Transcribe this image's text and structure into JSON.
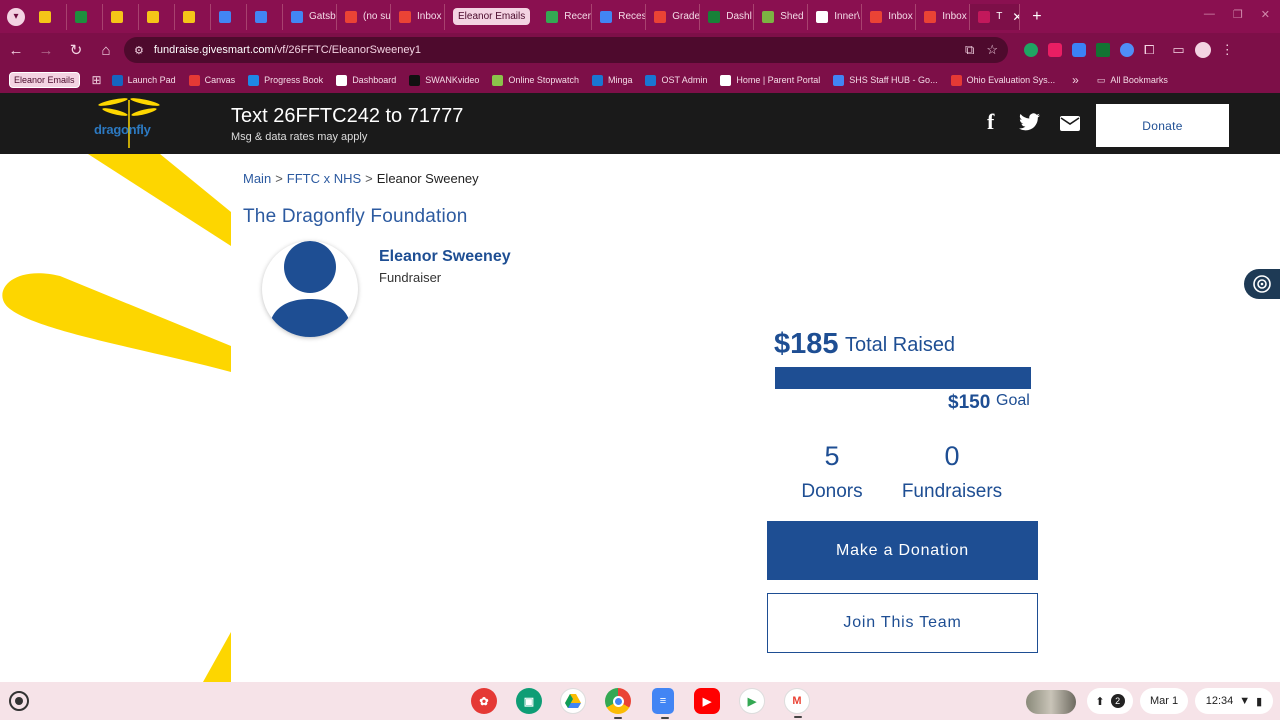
{
  "browser": {
    "tabs": [
      {
        "label": "",
        "color": "#f5c518"
      },
      {
        "label": "",
        "color": "#1e8e3e"
      },
      {
        "label": "",
        "color": "#f5c518"
      },
      {
        "label": "",
        "color": "#f5c518"
      },
      {
        "label": "",
        "color": "#f5c518"
      },
      {
        "label": "",
        "color": "#4285f4"
      },
      {
        "label": "",
        "color": "#4285f4"
      },
      {
        "label": "Gatsb",
        "color": "#4285f4"
      },
      {
        "label": "(no su",
        "color": "#ea4335"
      },
      {
        "label": "Inbox",
        "color": "#ea4335"
      },
      {
        "label": "Eleanor Emails",
        "color": ""
      },
      {
        "label": "Recer",
        "color": "#34a853"
      },
      {
        "label": "Reces",
        "color": "#4285f4"
      },
      {
        "label": "Grade",
        "color": "#ea4335"
      },
      {
        "label": "Dashl",
        "color": "#188038"
      },
      {
        "label": "Shed",
        "color": "#7cb342"
      },
      {
        "label": "Inner\\",
        "color": "#ffffff"
      },
      {
        "label": "Inbox",
        "color": "#ea4335"
      },
      {
        "label": "Inbox",
        "color": "#ea4335"
      },
      {
        "label": "T",
        "color": "#c2185b"
      }
    ],
    "new_tab": "+",
    "url_host": "fundraise.givesmart.com",
    "url_path": "/vf/26FFTC/EleanorSweeney1",
    "bookmarks": {
      "pill": "Eleanor Emails",
      "items": [
        {
          "label": "Launch Pad",
          "color": "#1565c0"
        },
        {
          "label": "Canvas",
          "color": "#e53935"
        },
        {
          "label": "Progress Book",
          "color": "#1e88e5"
        },
        {
          "label": "Dashboard",
          "color": "#ffffff"
        },
        {
          "label": "SWANKvideo",
          "color": "#111111"
        },
        {
          "label": "Online Stopwatch",
          "color": "#8bc34a"
        },
        {
          "label": "Minga",
          "color": "#1976d2"
        },
        {
          "label": "OST Admin",
          "color": "#1976d2"
        },
        {
          "label": "Home | Parent Portal",
          "color": "#ffffff"
        },
        {
          "label": "SHS Staff HUB - Go...",
          "color": "#4285f4"
        },
        {
          "label": "Ohio Evaluation Sys...",
          "color": "#e53935"
        }
      ],
      "more": "»",
      "all_bookmarks": "All Bookmarks"
    }
  },
  "site": {
    "logo_text": "dragonfly",
    "logo_tag": "the dragonfly foundation",
    "text_line": "Text 26FFTC242 to 71777",
    "text_sub": "Msg & data rates may apply",
    "donate_label": "Donate",
    "brand_color": "#1e4e93",
    "accent_color": "#fdd600"
  },
  "breadcrumb": {
    "main": "Main",
    "team": "FFTC x NHS",
    "current": "Eleanor Sweeney",
    "sep": ">"
  },
  "org_name": "The Dragonfly Foundation",
  "fundraiser": {
    "name": "Eleanor Sweeney",
    "role": "Fundraiser"
  },
  "stats": {
    "raised_amount": "$185",
    "raised_label": "Total Raised",
    "goal_amount": "$150",
    "goal_label": "Goal",
    "progress_fraction": 1.0,
    "donors_count": "5",
    "donors_label": "Donors",
    "fundraisers_count": "0",
    "fundraisers_label": "Fundraisers"
  },
  "actions": {
    "make_donation": "Make a Donation",
    "join_team": "Join This Team"
  },
  "shelf": {
    "date": "Mar 1",
    "time": "12:34",
    "notifications": "2"
  }
}
